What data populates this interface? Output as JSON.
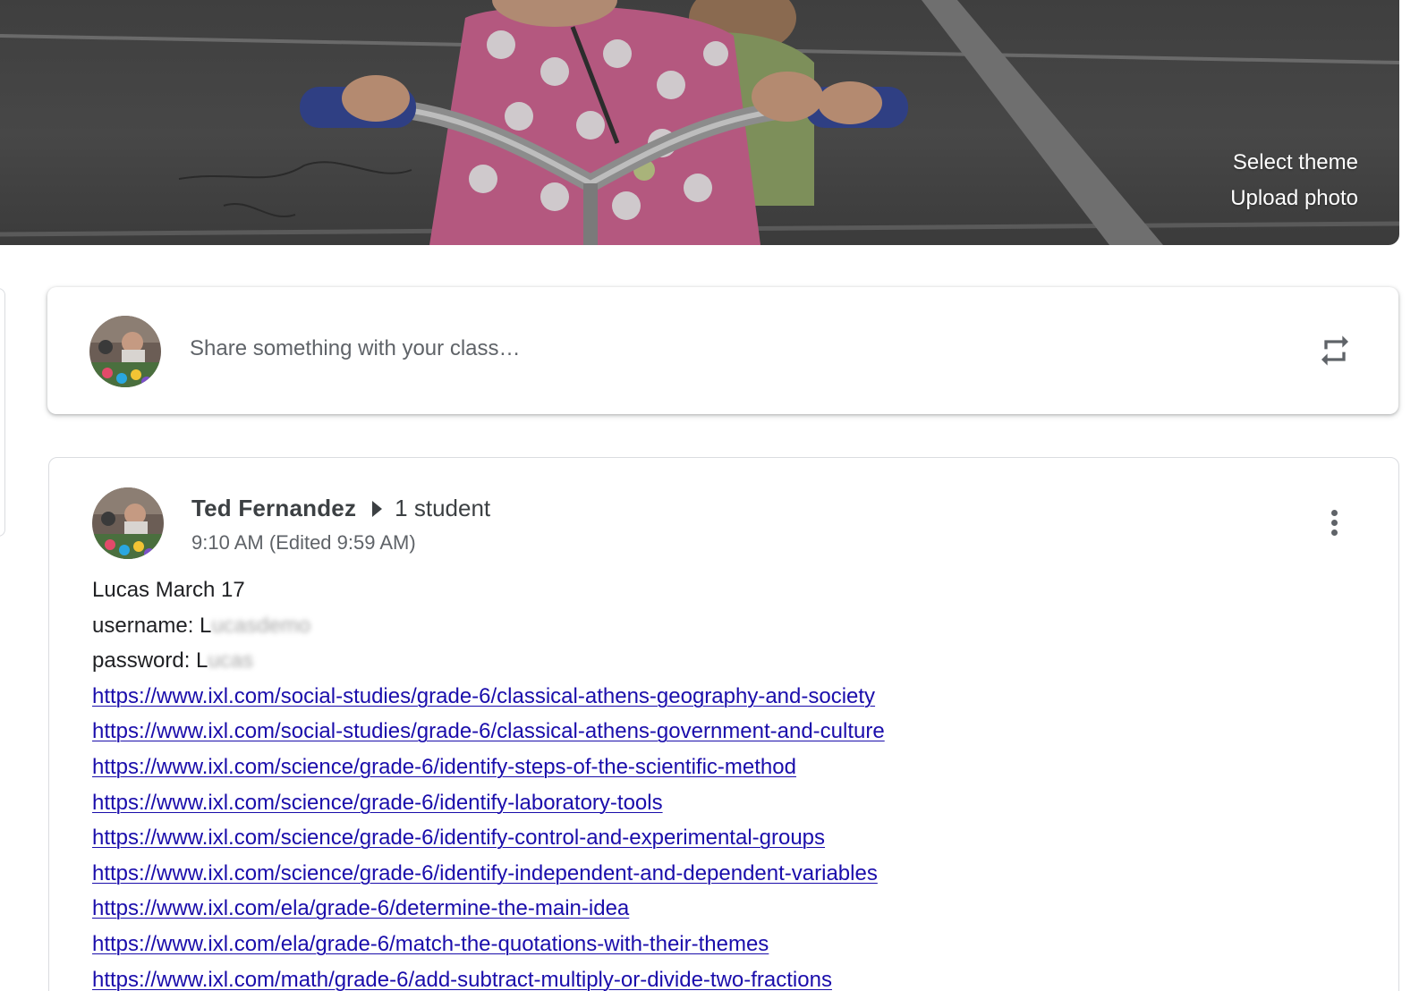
{
  "banner": {
    "select_theme": "Select theme",
    "upload_photo": "Upload photo"
  },
  "share_box": {
    "placeholder": "Share something with your class…",
    "repost_icon": "repost-icon",
    "avatar": "avatar"
  },
  "post": {
    "author": "Ted Fernandez",
    "audience": "1 student",
    "timestamp": "9:10 AM (Edited 9:59 AM)",
    "more_icon": "more-vert-icon",
    "lines": {
      "title": "Lucas March 17",
      "username_label": "username: L",
      "username_redacted": "ucasdemo",
      "password_label": "password: L",
      "password_redacted": "ucas"
    },
    "links": [
      "https://www.ixl.com/social-studies/grade-6/classical-athens-geography-and-society",
      "https://www.ixl.com/social-studies/grade-6/classical-athens-government-and-culture",
      "https://www.ixl.com/science/grade-6/identify-steps-of-the-scientific-method",
      "https://www.ixl.com/science/grade-6/identify-laboratory-tools",
      "https://www.ixl.com/science/grade-6/identify-control-and-experimental-groups",
      "https://www.ixl.com/science/grade-6/identify-independent-and-dependent-variables",
      "https://www.ixl.com/ela/grade-6/determine-the-main-idea",
      "https://www.ixl.com/ela/grade-6/match-the-quotations-with-their-themes",
      "https://www.ixl.com/math/grade-6/add-subtract-multiply-or-divide-two-fractions"
    ]
  },
  "colors": {
    "link": "#1a0dab",
    "text": "#202124",
    "secondary": "#5f6368"
  }
}
